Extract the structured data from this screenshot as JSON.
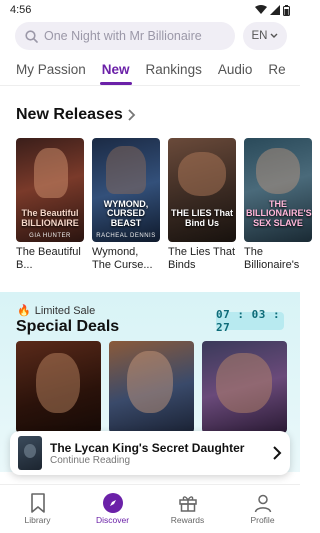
{
  "status": {
    "time": "4:56"
  },
  "search": {
    "placeholder": "One Night with Mr Billionaire",
    "language": "EN"
  },
  "tabs": [
    {
      "label": "My Passion"
    },
    {
      "label": "New"
    },
    {
      "label": "Rankings"
    },
    {
      "label": "Audio"
    },
    {
      "label": "Re"
    }
  ],
  "new_releases": {
    "title": "New Releases",
    "books": [
      {
        "cover_text": "The Beautiful BILLIONAIRE",
        "cover_author": "GIA HUNTER",
        "title": "The Beautiful B..."
      },
      {
        "cover_text": "WYMOND, CURSED BEAST",
        "cover_author": "RACHEAL DENNIS",
        "title": "Wymond, The Curse..."
      },
      {
        "cover_text": "THE LIES That Bind Us",
        "cover_author": "",
        "title": "The Lies That Binds"
      },
      {
        "cover_text": "THE BILLIONAIRE'S SEX SLAVE",
        "cover_author": "",
        "title": "The Billionaire's"
      }
    ]
  },
  "special_deals": {
    "badge": "Limited Sale",
    "title": "Special Deals",
    "timer": "07 : 03 : 27"
  },
  "continue_reading": {
    "title": "The Lycan King's Secret Daughter",
    "subtitle": "Continue Reading"
  },
  "bottom_nav": [
    {
      "label": "Library"
    },
    {
      "label": "Discover"
    },
    {
      "label": "Rewards"
    },
    {
      "label": "Profile"
    }
  ],
  "colors": {
    "accent": "#6b21a8",
    "deal_bg": "#d8f3f6",
    "timer": "#0d6b78"
  }
}
